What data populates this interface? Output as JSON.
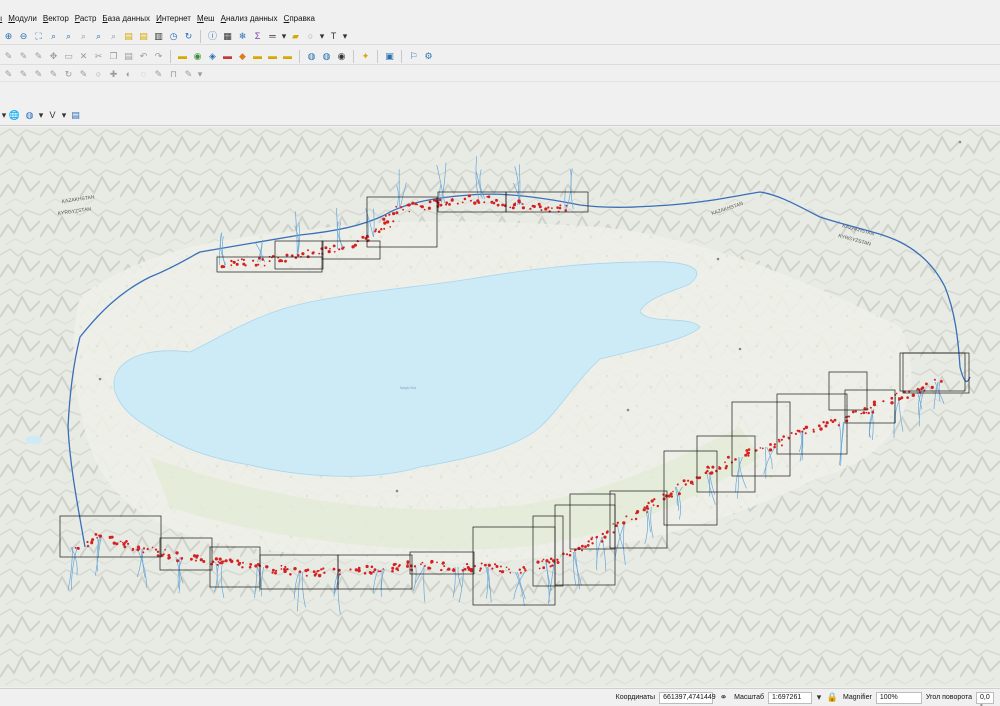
{
  "menubar": {
    "items": [
      "Модули",
      "Вектор",
      "Растр",
      "База данных",
      "Интернет",
      "Меш",
      "Анализ данных",
      "Справка"
    ]
  },
  "toolbars": {
    "row1_icons": [
      "zoom-in-icon",
      "zoom-out-icon",
      "zoom-full-icon",
      "zoom-selection-icon",
      "zoom-layer-icon",
      "zoom-native-icon",
      "zoom-last-icon",
      "zoom-next-icon",
      "new-bookmark-icon",
      "show-bookmarks-icon",
      "temporal-controller-icon",
      "refresh-icon",
      "identify-icon",
      "attribute-table-icon",
      "statistics-icon",
      "sum-icon",
      "measure-icon",
      "annotation-icon",
      "text-annotation-icon"
    ],
    "row2_icons": [
      "digitize-icon",
      "edit-layer-icon",
      "add-feature-icon",
      "move-feature-icon",
      "node-tool-icon",
      "delete-icon",
      "cut-icon",
      "copy-icon",
      "paste-icon",
      "undo-icon",
      "redo-icon",
      "label-icon",
      "pin-label-icon",
      "rotate-label-icon",
      "change-label-icon",
      "highlight-label-icon",
      "move-label-icon",
      "show-label-icon",
      "label-tool-icon",
      "select-feature-icon",
      "select-polygon-icon",
      "deselect-icon",
      "plugin-icon",
      "python-icon",
      "help-icon"
    ],
    "row4_icons": [
      "add-layer-icon",
      "add-wms-icon",
      "add-virtual-layer-icon",
      "new-layer-icon"
    ]
  },
  "map": {
    "labels": {
      "kazakhstan_west": "KAZAKHSTAN",
      "kyrgyzstan_west": "KYRGYZSTAN",
      "kazakhstan_east": "KAZAKHSTAN",
      "kyrgyzstan_east": "KYRGYZSTAN",
      "lake": "Issyk-Kul"
    },
    "colors": {
      "lake": "#cdeaf7",
      "terrain": "#e9ebe6",
      "boundary": "#3a6fb8",
      "rivers": "#6aa7d6",
      "points": "#d42020",
      "tiles": "#1a1a1a"
    }
  },
  "statusbar": {
    "coord_label": "Координаты",
    "coord_value": "661397,4741449",
    "scale_label": "Масштаб",
    "scale_value": "1:697261",
    "magnifier_label": "Magnifier",
    "magnifier_value": "100%",
    "rotation_label": "Угол поворота",
    "rotation_value": "0,0 °"
  }
}
